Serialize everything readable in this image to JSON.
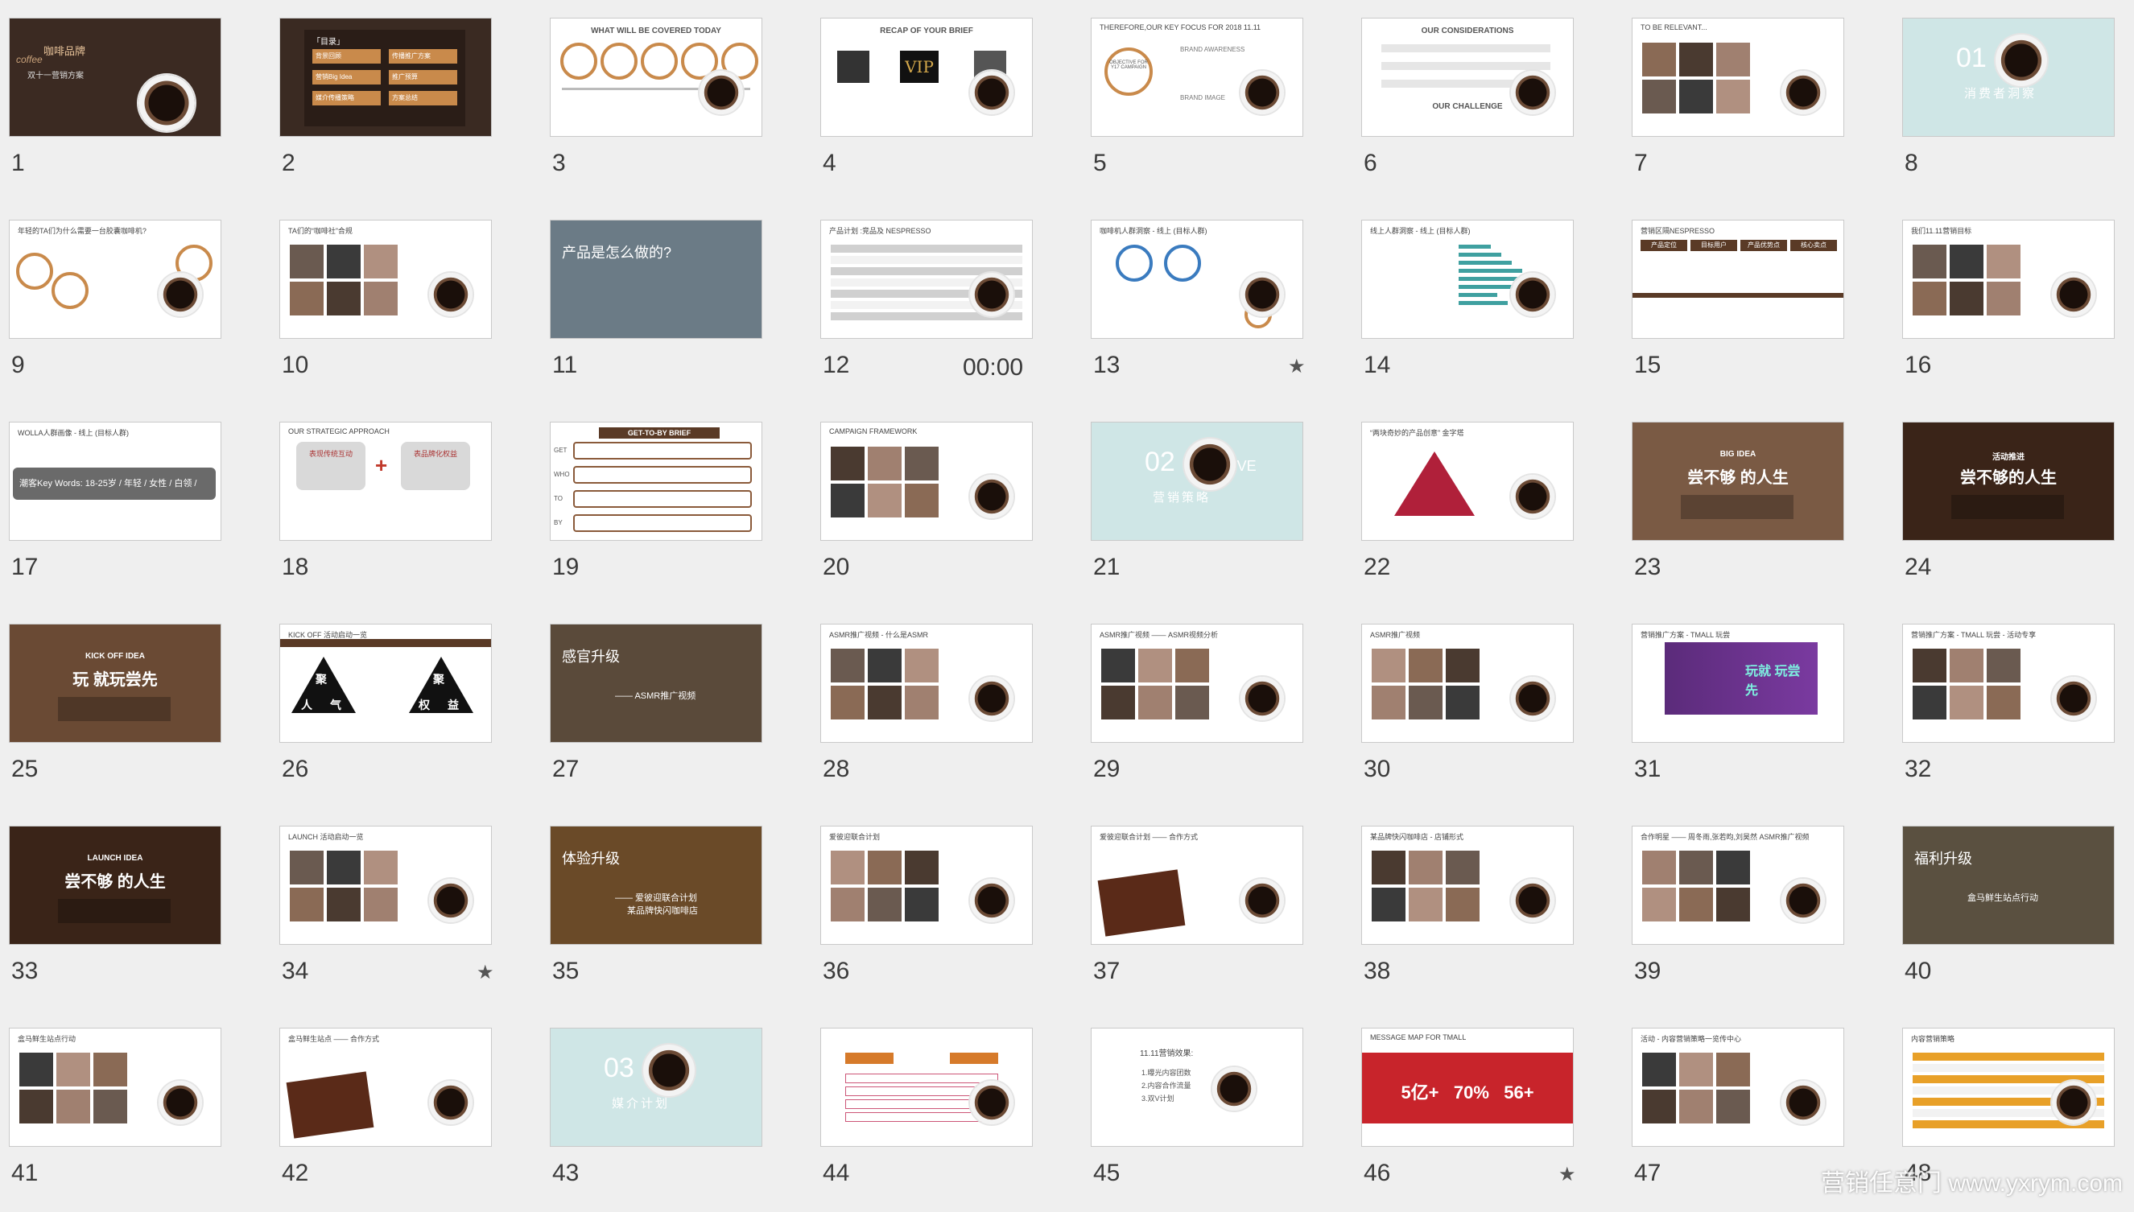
{
  "slides": [
    {
      "num": "1",
      "title": "咖啡品牌",
      "sub": "双十一营销方案",
      "tag": "coffee",
      "theme": "cover",
      "bg": "#3b2a22"
    },
    {
      "num": "2",
      "title": "「目录」",
      "theme": "toc",
      "bg": "#3a2a22",
      "items": [
        "背景回顾",
        "营销Big Idea",
        "媒介传播策略",
        "传播推广方案",
        "推广预算",
        "方案总结"
      ]
    },
    {
      "num": "3",
      "title": "WHAT WILL BE COVERED TODAY",
      "theme": "rings",
      "bg": "#ffffff"
    },
    {
      "num": "4",
      "title": "RECAP OF YOUR BRIEF",
      "theme": "products",
      "bg": "#ffffff",
      "badge": "VIP"
    },
    {
      "num": "5",
      "title": "THEREFORE,OUR KEY FOCUS FOR 2018 11.11",
      "theme": "focus",
      "bg": "#ffffff",
      "ring_text": "OBJECTIVE FOR Y17 CAMPAIGN",
      "label1": "BRAND AWARENESS",
      "label2": "BRAND IMAGE"
    },
    {
      "num": "6",
      "title": "OUR CONSIDERATIONS",
      "theme": "text",
      "bg": "#ffffff",
      "sub": "OUR CHALLENGE"
    },
    {
      "num": "7",
      "title": "TO BE RELEVANT...",
      "theme": "photo-right",
      "bg": "#ffffff"
    },
    {
      "num": "8",
      "title": "01",
      "sub": "Insight",
      "sub2": "消费者洞察",
      "theme": "section",
      "bg": "#cfe6e6"
    },
    {
      "num": "9",
      "title": "年轻的TA们为什么需要一台胶囊咖啡机?",
      "theme": "circles",
      "bg": "#ffffff"
    },
    {
      "num": "10",
      "title": "TA们的“咖啡社”合规",
      "theme": "photo-left",
      "bg": "#ffffff"
    },
    {
      "num": "11",
      "title": "产品是怎么做的?",
      "theme": "photo-dark",
      "bg": "#6b7b86"
    },
    {
      "num": "12",
      "title": "产品计划 :竞品及 NESPRESSO",
      "theme": "table",
      "bg": "#ffffff"
    },
    {
      "num": "13",
      "title": "咖啡机人群洞察 - 线上 (目标人群)",
      "theme": "donuts",
      "bg": "#ffffff"
    },
    {
      "num": "14",
      "title": "线上人群洞察 - 线上 (目标人群)",
      "theme": "bars",
      "bg": "#ffffff"
    },
    {
      "num": "15",
      "title": "营销区隔NESPRESSO",
      "theme": "columns",
      "bg": "#ffffff",
      "cols": [
        "产品定位",
        "目标用户",
        "产品优势点",
        "核心卖点"
      ]
    },
    {
      "num": "16",
      "title": "我们11.11营销目标",
      "theme": "products2",
      "bg": "#ffffff"
    },
    {
      "num": "17",
      "title": "WOLLA人群画像 - 线上 (目标人群)",
      "theme": "keyword",
      "bg": "#ffffff",
      "keyword": "潮客Key Words: 18-25岁 / 年轻 / 女性 / 白领 /"
    },
    {
      "num": "18",
      "title": "OUR STRATEGIC APPROACH",
      "theme": "plus",
      "bg": "#ffffff",
      "a": "表现传统互动",
      "b": "表品牌化权益"
    },
    {
      "num": "19",
      "title": "GET-TO-BY BRIEF",
      "theme": "getby",
      "bg": "#ffffff",
      "rows": [
        "GET",
        "WHO",
        "TO",
        "BY"
      ]
    },
    {
      "num": "20",
      "title": "CAMPAIGN FRAMEWORK",
      "theme": "framework",
      "bg": "#ffffff"
    },
    {
      "num": "21",
      "title": "02",
      "sub": "CREATIVE",
      "sub2": "营销策略",
      "theme": "section",
      "bg": "#cfe6e6"
    },
    {
      "num": "22",
      "title": "“两块奇妙的产品创意” 金字塔",
      "theme": "pyramid",
      "bg": "#ffffff"
    },
    {
      "num": "23",
      "title": "BIG IDEA",
      "sub": "尝不够 的人生",
      "theme": "coffee-bg",
      "bg": "#7a5a44"
    },
    {
      "num": "24",
      "title": "活动推进",
      "sub": "尝不够的人生",
      "theme": "beans",
      "bg": "#3a2418"
    },
    {
      "num": "25",
      "title": "KICK OFF IDEA",
      "sub": "玩 就玩尝先",
      "theme": "coffee-bg",
      "bg": "#6a4a34"
    },
    {
      "num": "26",
      "title": "KICK OFF 活动启动一览",
      "theme": "triangles",
      "bg": "#ffffff",
      "t1": "聚",
      "t2": "人",
      "t3": "气",
      "t4": "聚",
      "t5": "权",
      "t6": "益"
    },
    {
      "num": "27",
      "title": "感官升级",
      "sub": "—— ASMR推广视频",
      "theme": "photo-dark",
      "bg": "#5a4a3a"
    },
    {
      "num": "28",
      "title": "ASMR推广视频 - 什么是ASMR",
      "theme": "gallery",
      "bg": "#ffffff"
    },
    {
      "num": "29",
      "title": "ASMR推广视频 —— ASMR视频分析",
      "theme": "gallery2",
      "bg": "#ffffff"
    },
    {
      "num": "30",
      "title": "ASMR推广视频",
      "theme": "gallery3",
      "bg": "#ffffff"
    },
    {
      "num": "31",
      "title": "营销推广方案 - TMALL 玩尝",
      "sub": "玩就 玩尝先",
      "theme": "promo",
      "bg": "#ffffff"
    },
    {
      "num": "32",
      "title": "营销推广方案 - TMALL 玩尝 - 活动专享",
      "theme": "product-pack",
      "bg": "#ffffff"
    },
    {
      "num": "33",
      "title": "LAUNCH IDEA",
      "sub": "尝不够 的人生",
      "theme": "beans",
      "bg": "#3a2418"
    },
    {
      "num": "34",
      "title": "LAUNCH 活动启动一览",
      "theme": "machine",
      "bg": "#ffffff"
    },
    {
      "num": "35",
      "title": "体验升级",
      "sub": "—— 爱彼迎联合计划",
      "sub2": "某品牌快闪咖啡店",
      "theme": "photo-warm",
      "bg": "#6a4a28"
    },
    {
      "num": "36",
      "title": "爱彼迎联合计划",
      "theme": "house",
      "bg": "#ffffff"
    },
    {
      "num": "37",
      "title": "爱彼迎联合计划 —— 合作方式",
      "theme": "brown-card",
      "bg": "#ffffff"
    },
    {
      "num": "38",
      "title": "某品牌快闪咖啡店 - 店铺形式",
      "theme": "cart",
      "bg": "#ffffff"
    },
    {
      "num": "39",
      "title": "合作明星 —— 周冬雨,张若昀,刘昊然 ASMR推广视频",
      "theme": "faces",
      "bg": "#ffffff"
    },
    {
      "num": "40",
      "title": "福利升级",
      "sub": "盒马鲜生站点行动",
      "theme": "photo-store",
      "bg": "#5a5040"
    },
    {
      "num": "41",
      "title": "盒马鲜生站点行动",
      "theme": "store-brown",
      "bg": "#ffffff"
    },
    {
      "num": "42",
      "title": "盒马鲜生站点 —— 合作方式",
      "theme": "brown-card2",
      "bg": "#ffffff"
    },
    {
      "num": "43",
      "title": "03",
      "sub": "TMALL",
      "sub2": "媒介计划",
      "theme": "section",
      "bg": "#cfe6e6"
    },
    {
      "num": "44",
      "title": "",
      "theme": "flow",
      "bg": "#ffffff"
    },
    {
      "num": "45",
      "title": "11.11营销效果:",
      "theme": "list",
      "bg": "#ffffff",
      "items": [
        "1.曝光内容团数",
        "2.内容合作流量",
        "3.双V计划"
      ]
    },
    {
      "num": "46",
      "title": "MESSAGE MAP FOR TMALL",
      "theme": "redstats",
      "bg": "#ffffff",
      "stats": "5亿+   70%   56+"
    },
    {
      "num": "47",
      "title": "活动 - 内容营销策略一览传中心",
      "theme": "network",
      "bg": "#ffffff"
    },
    {
      "num": "48",
      "title": "内容营销策略",
      "theme": "grid-table",
      "bg": "#ffffff"
    }
  ],
  "extras": {
    "time": "00:00",
    "star_glyph": "★",
    "starred": [
      "13",
      "34",
      "46"
    ],
    "watermark": "营销任意门 www.yxrym.com"
  }
}
